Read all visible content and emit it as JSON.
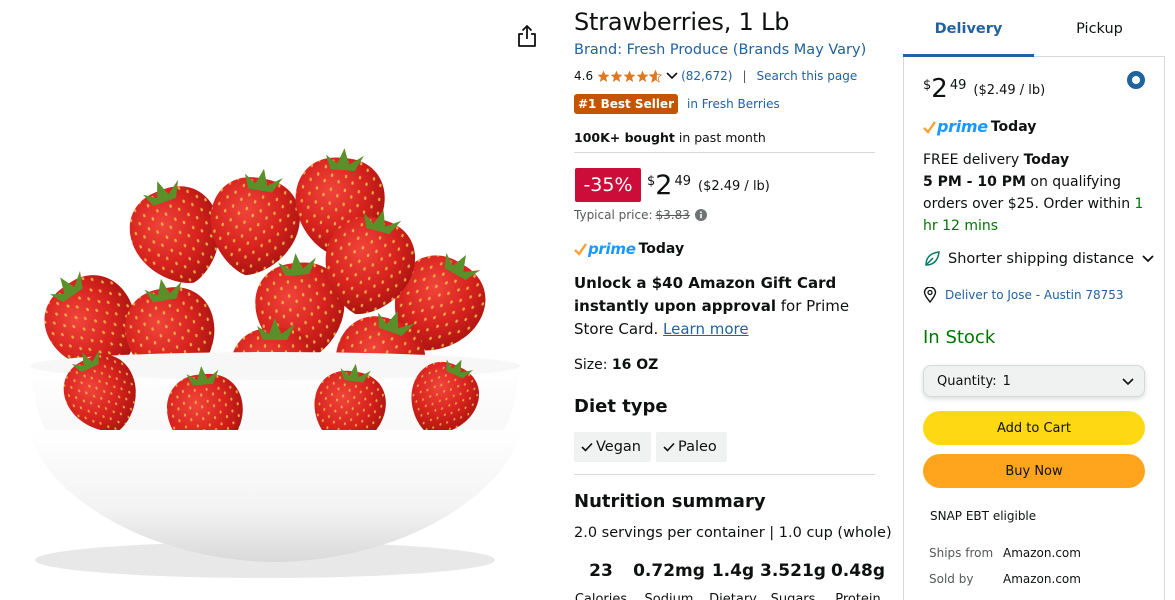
{
  "product": {
    "title": "Strawberries, 1 Lb",
    "brand": "Brand: Fresh Produce (Brands May Vary)",
    "rating": "4.6",
    "rating_count": "(82,672)",
    "search_page": "Search this page",
    "best_seller": "#1 Best Seller",
    "category_link": "in Fresh Berries",
    "bought_bold": "100K+ bought",
    "bought_rest": " in past month",
    "image_icon": "strawberry-bowl-image",
    "share_icon": "share-icon"
  },
  "pricing": {
    "discount": "-35%",
    "currency": "$",
    "whole": "2",
    "fraction": "49",
    "unit_price": "($2.49 / lb)",
    "typical_label": "Typical price:",
    "typical_value": "$3.83"
  },
  "prime": {
    "brand": "prime",
    "today": "Today",
    "color": "#1a98ff"
  },
  "gift": {
    "bold": "Unlock a $40 Amazon Gift Card instantly upon approval",
    "rest": " for Prime Store Card. ",
    "link": "Learn more"
  },
  "size": {
    "label": "Size: ",
    "value": "16 OZ"
  },
  "diet": {
    "title": "Diet type",
    "chips": [
      "Vegan",
      "Paleo"
    ]
  },
  "nutrition": {
    "title": "Nutrition summary",
    "servings": "2.0 servings per container | 1.0 cup (whole)",
    "items": [
      {
        "value": "23",
        "label": "Calories"
      },
      {
        "value": "0.72mg",
        "label": "Sodium"
      },
      {
        "value": "1.4g",
        "label": "Dietary"
      },
      {
        "value": "3.521g",
        "label": "Sugars"
      },
      {
        "value": "0.48g",
        "label": "Protein"
      }
    ]
  },
  "buybox": {
    "tabs": [
      "Delivery",
      "Pickup"
    ],
    "currency": "$",
    "whole": "2",
    "fraction": "49",
    "unit_price": "($2.49 / lb)",
    "delivery_line1_plain": "FREE delivery ",
    "delivery_line1_bold": "Today",
    "delivery_time": "5 PM - 10 PM",
    "delivery_rest": " on qualifying orders over $25. Order within ",
    "delivery_countdown": "1 hr 12 mins",
    "shorter_shipping": "Shorter shipping distance",
    "deliver_to": "Deliver to Jose - Austin 78753",
    "in_stock": "In Stock",
    "quantity_label": "Quantity:",
    "quantity_value": "1",
    "add_to_cart": "Add to Cart",
    "buy_now": "Buy Now",
    "snap": "SNAP EBT eligible",
    "ships_from_label": "Ships from",
    "ships_from_value": "Amazon.com",
    "sold_by_label": "Sold by",
    "sold_by_value": "Amazon.com",
    "colors": {
      "add_to_cart": "#ffd814",
      "buy_now": "#ffa41c",
      "link": "#2162a1",
      "in_stock": "#007600",
      "discount": "#cc0c39",
      "best_seller": "#c45500"
    }
  }
}
